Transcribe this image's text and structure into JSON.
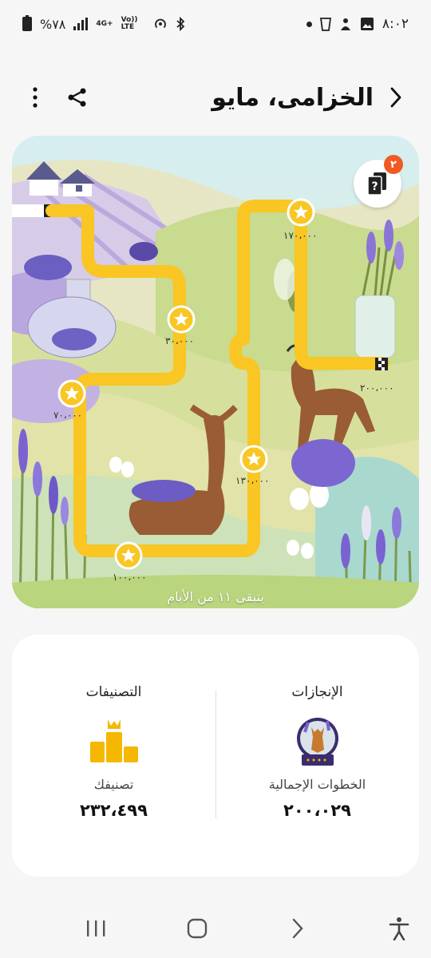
{
  "status_bar": {
    "time": "٨:٠٢",
    "battery": "%٧٨",
    "network": "4G+",
    "volte": "Vo)) LTE"
  },
  "header": {
    "title": "الخزامى، مايو"
  },
  "challenge": {
    "days_left": "يتبقى ١١ من الأيام",
    "help_badge_count": "٢",
    "milestones": [
      {
        "value": "١٠٠،٠٠٠",
        "name": "milestone-100000"
      },
      {
        "value": "٧٠،٠٠٠",
        "name": "milestone-70000"
      },
      {
        "value": "٣٠،٠٠٠",
        "name": "milestone-30000"
      },
      {
        "value": "١٣٠،٠٠٠",
        "name": "milestone-130000"
      },
      {
        "value": "١٧٠،٠٠٠",
        "name": "milestone-170000"
      },
      {
        "value": "٢٠٠،٠٠٠",
        "name": "milestone-200000"
      }
    ],
    "colors": {
      "path": "#f9c623",
      "star_fill": "#f9c623"
    }
  },
  "stats": {
    "achievements": {
      "heading": "الإنجازات",
      "label": "الخطوات الإجمالية",
      "value": "٢٠٠،٠٢٩"
    },
    "rankings": {
      "heading": "التصنيفات",
      "label": "تصنيفك",
      "value": "٢٣٢،٤٩٩"
    }
  },
  "icons": [
    "battery-icon",
    "signal-icon",
    "hotspot-icon",
    "bluetooth-icon",
    "screenshot-icon",
    "cup-icon",
    "gallery-icon",
    "back-icon",
    "share-icon",
    "more-icon",
    "help-card-icon",
    "trophy-badge-icon",
    "podium-icon",
    "recents-icon",
    "home-icon",
    "forward-icon",
    "accessibility-icon"
  ]
}
